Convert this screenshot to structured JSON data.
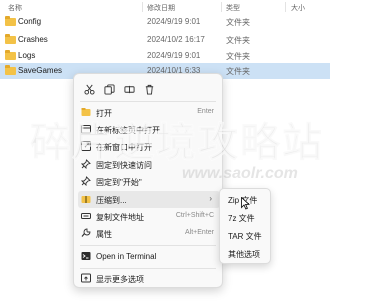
{
  "header": {
    "name": "名称",
    "modified": "修改日期",
    "type": "类型",
    "size": "大小"
  },
  "files": [
    {
      "name": "Config",
      "date": "2024/9/19 9:01",
      "type": "文件夹"
    },
    {
      "name": "Crashes",
      "date": "2024/10/2 16:17",
      "type": "文件夹"
    },
    {
      "name": "Logs",
      "date": "2024/9/19 9:01",
      "type": "文件夹"
    },
    {
      "name": "SaveGames",
      "date": "2024/10/1 6:33",
      "type": "文件夹"
    }
  ],
  "toolbar_icons": [
    "cut-icon",
    "copy-icon",
    "rename-icon",
    "delete-icon"
  ],
  "menu": {
    "open": {
      "label": "打开",
      "shortcut": "Enter"
    },
    "open_new_tab": {
      "label": "在新标签页中打开"
    },
    "open_new_window": {
      "label": "在新窗口中打开"
    },
    "pin_quick_access": {
      "label": "固定到快速访问"
    },
    "pin_start": {
      "label": "固定到\"开始\""
    },
    "compress": {
      "label": "压缩到..."
    },
    "copy_path": {
      "label": "复制文件地址",
      "shortcut": "Ctrl+Shift+C"
    },
    "properties": {
      "label": "属性",
      "shortcut": "Alt+Enter"
    },
    "terminal": {
      "label": "Open in Terminal"
    },
    "more_options": {
      "label": "显示更多选项"
    }
  },
  "submenu": {
    "zip": "Zip 文件",
    "7z": "7z 文件",
    "tar": "TAR 文件",
    "other": "其他选项"
  },
  "watermark": {
    "text": "碎片逆境攻略站",
    "url": "www.saolr.com"
  },
  "colors": {
    "selection": "#cce1f5",
    "folder": "#f3c247",
    "accent": "#0067c0"
  }
}
